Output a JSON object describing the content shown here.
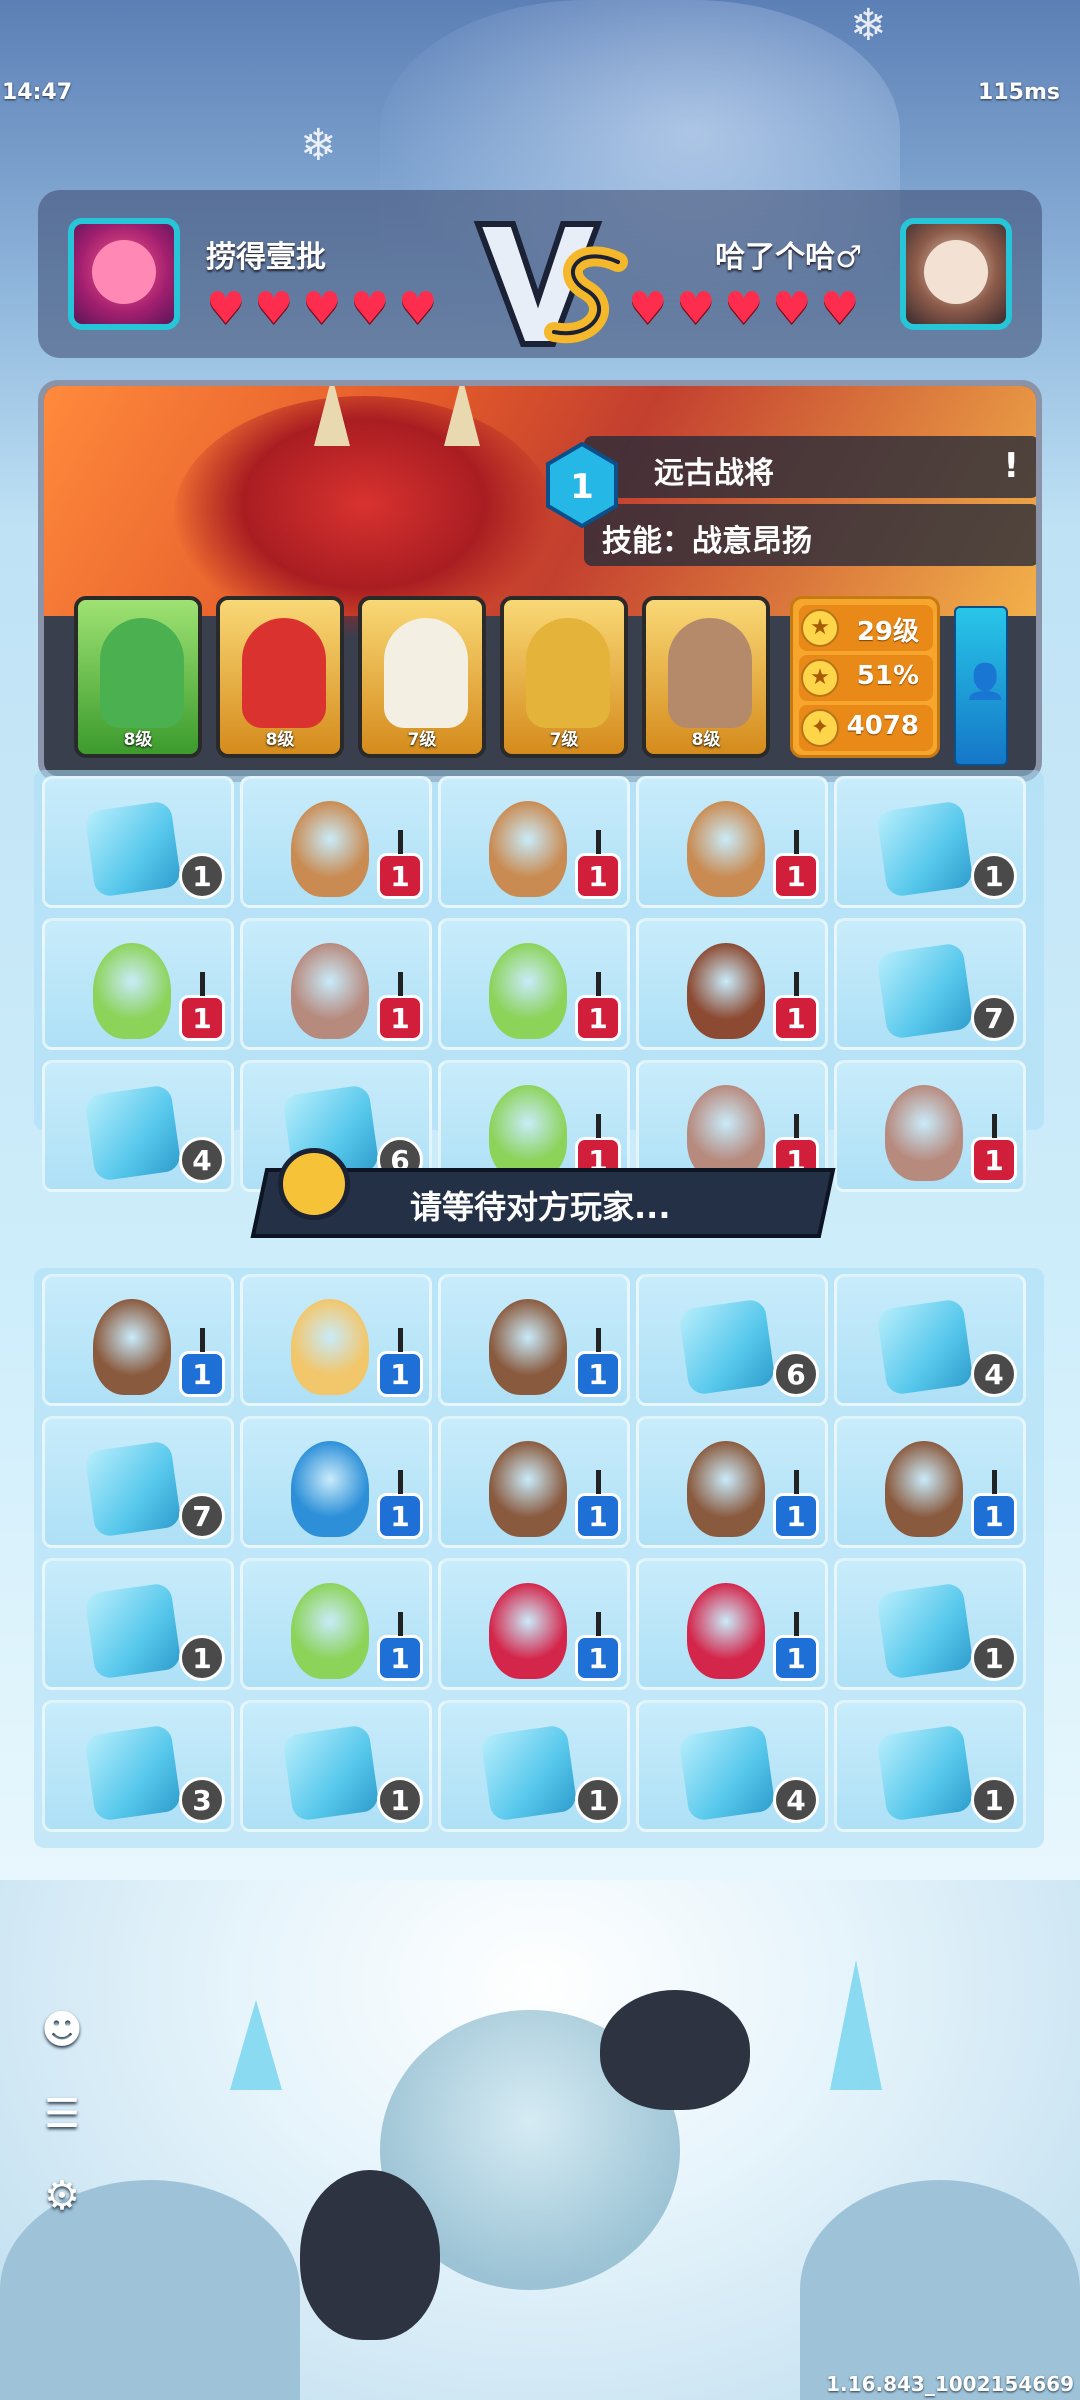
{
  "status": {
    "time": "14:47",
    "ping": "115ms"
  },
  "header": {
    "player_left": {
      "name": "捞得壹批",
      "hearts": 5
    },
    "player_right": {
      "name": "哈了个哈♂",
      "hearts": 5
    },
    "vs_label": "VS"
  },
  "panel": {
    "level": "1",
    "title": "远古战将",
    "skill": "技能：战意昂扬",
    "info_glyph": "!",
    "cards": [
      {
        "level": "8级",
        "colors": [
          "#7ed957",
          "#3c9b2d"
        ]
      },
      {
        "level": "8级",
        "colors": [
          "#f4c24a",
          "#d58b1c"
        ]
      },
      {
        "level": "7级",
        "colors": [
          "#f4c24a",
          "#d58b1c"
        ]
      },
      {
        "level": "7级",
        "colors": [
          "#f4c24a",
          "#d58b1c"
        ]
      },
      {
        "level": "8级",
        "colors": [
          "#f4c24a",
          "#d58b1c"
        ]
      }
    ],
    "stats": [
      {
        "icon": "★",
        "value": "29级"
      },
      {
        "icon": "★",
        "value": "51%"
      },
      {
        "icon": "✦",
        "value": "4078"
      }
    ],
    "add_friend_icon": "person-add-icon"
  },
  "opponent_board": {
    "rows": [
      [
        {
          "unit": "ice",
          "badge": "1",
          "type": "dark"
        },
        {
          "unit": "animal",
          "badge": "1",
          "type": "red"
        },
        {
          "unit": "animal",
          "badge": "1",
          "type": "red"
        },
        {
          "unit": "animal",
          "badge": "1",
          "type": "red"
        },
        {
          "unit": "ice",
          "badge": "1",
          "type": "dark"
        }
      ],
      [
        {
          "unit": "snake",
          "badge": "1",
          "type": "red"
        },
        {
          "unit": "rabbit",
          "badge": "1",
          "type": "red"
        },
        {
          "unit": "snake",
          "badge": "1",
          "type": "red"
        },
        {
          "unit": "fox",
          "badge": "1",
          "type": "red"
        },
        {
          "unit": "ice",
          "badge": "7",
          "type": "dark"
        }
      ],
      [
        {
          "unit": "ice",
          "badge": "4",
          "type": "dark"
        },
        {
          "unit": "ice",
          "badge": "6",
          "type": "dark"
        },
        {
          "unit": "snake",
          "badge": "1",
          "type": "red"
        },
        {
          "unit": "rabbit",
          "badge": "1",
          "type": "red"
        },
        {
          "unit": "rabbit",
          "badge": "1",
          "type": "red"
        }
      ]
    ]
  },
  "wait_text": "请等待对方玩家...",
  "player_board": {
    "rows": [
      [
        {
          "unit": "otter",
          "badge": "1",
          "type": "blue"
        },
        {
          "unit": "lion",
          "badge": "1",
          "type": "blue"
        },
        {
          "unit": "otter",
          "badge": "1",
          "type": "blue"
        },
        {
          "unit": "ice",
          "badge": "6",
          "type": "dark"
        },
        {
          "unit": "ice",
          "badge": "4",
          "type": "dark"
        }
      ],
      [
        {
          "unit": "ice",
          "badge": "7",
          "type": "dark"
        },
        {
          "unit": "seal",
          "badge": "1",
          "type": "blue"
        },
        {
          "unit": "otter",
          "badge": "1",
          "type": "blue"
        },
        {
          "unit": "otter",
          "badge": "1",
          "type": "blue"
        },
        {
          "unit": "otter",
          "badge": "1",
          "type": "blue"
        }
      ],
      [
        {
          "unit": "ice",
          "badge": "1",
          "type": "dark"
        },
        {
          "unit": "snake",
          "badge": "1",
          "type": "blue"
        },
        {
          "unit": "bug",
          "badge": "1",
          "type": "blue"
        },
        {
          "unit": "bug",
          "badge": "1",
          "type": "blue"
        },
        {
          "unit": "ice",
          "badge": "1",
          "type": "dark"
        }
      ],
      [
        {
          "unit": "ice",
          "badge": "3",
          "type": "dark"
        },
        {
          "unit": "ice",
          "badge": "1",
          "type": "dark"
        },
        {
          "unit": "ice",
          "badge": "1",
          "type": "dark"
        },
        {
          "unit": "ice",
          "badge": "4",
          "type": "dark"
        },
        {
          "unit": "ice",
          "badge": "1",
          "type": "dark"
        }
      ]
    ]
  },
  "side_buttons": [
    {
      "name": "emote-button",
      "icon": "emote-icon"
    },
    {
      "name": "list-button",
      "icon": "list-icon"
    },
    {
      "name": "settings-button",
      "icon": "gear-icon"
    }
  ],
  "version": "1.16.843_1002154669",
  "unit_colors": {
    "ice": "#57c8ec",
    "snake": "#8cd35a",
    "rabbit": "#b78a7e",
    "fox": "#8c4a32",
    "animal": "#c98b52",
    "otter": "#8a5a3e",
    "lion": "#f2c66a",
    "seal": "#2c8fd8",
    "bug": "#d4264b"
  }
}
